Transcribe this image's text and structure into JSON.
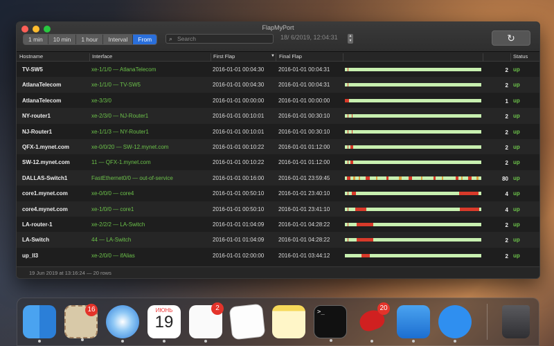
{
  "window": {
    "title": "FlapMyPort",
    "intervals": [
      "1 min",
      "10 min",
      "1 hour",
      "Interval",
      "From"
    ],
    "active_interval": "From",
    "search_placeholder": "Search",
    "date_value": "18/  6/2019, 12:04:31",
    "stepper_icon": "up-down-arrows-icon",
    "refresh_icon": "refresh-icon"
  },
  "columns": {
    "hostname": "Hostname",
    "interface": "Interface",
    "first_flap": "First Flap",
    "final_flap": "Final Flap",
    "status": "Status"
  },
  "rows": [
    {
      "host": "TV-SW5",
      "iface": "xe-1/1/0 — AtlanaTelecom",
      "first": "2016-01-01 00:04:30",
      "final": "2016-01-01 00:04:31",
      "count": "2",
      "status": "up"
    },
    {
      "host": "AtlanaTelecom",
      "iface": "xe-1/1/0 — TV-SW5",
      "first": "2016-01-01 00:04:30",
      "final": "2016-01-01 00:04:31",
      "count": "2",
      "status": "up"
    },
    {
      "host": "AtlanaTelecom",
      "iface": "xe-3/3/0",
      "first": "2016-01-01 00:00:00",
      "final": "2016-01-01 00:00:00",
      "count": "1",
      "status": "up"
    },
    {
      "host": "NY-router1",
      "iface": "xe-2/3/0 — NJ-Router1",
      "first": "2016-01-01 00:10:01",
      "final": "2016-01-01 00:30:10",
      "count": "2",
      "status": "up"
    },
    {
      "host": "NJ-Router1",
      "iface": "xe-1/1/3 — NY-Router1",
      "first": "2016-01-01 00:10:01",
      "final": "2016-01-01 00:30:10",
      "count": "2",
      "status": "up"
    },
    {
      "host": "QFX-1.mynet.com",
      "iface": "xe-0/0/20 — SW-12.mynet.com",
      "first": "2016-01-01 00:10:22",
      "final": "2016-01-01 01:12:00",
      "count": "2",
      "status": "up"
    },
    {
      "host": "SW-12.mynet.com",
      "iface": "11 — QFX-1.mynet.com",
      "first": "2016-01-01 00:10:22",
      "final": "2016-01-01 01:12:00",
      "count": "2",
      "status": "up"
    },
    {
      "host": "DALLAS-Switch1",
      "iface": "FastEthernet0/0 — out-of-service",
      "first": "2016-01-01 00:16:00",
      "final": "2016-01-01 23:59:45",
      "count": "80",
      "status": "up"
    },
    {
      "host": "core1.mynet.com",
      "iface": "xe-0/0/0 — core4",
      "first": "2016-01-01 00:50:10",
      "final": "2016-01-01 23:40:10",
      "count": "4",
      "status": "up"
    },
    {
      "host": "core4.mynet.com",
      "iface": "xe-1/0/0 — core1",
      "first": "2016-01-01 00:50:10",
      "final": "2016-01-01 23:41:10",
      "count": "4",
      "status": "up"
    },
    {
      "host": "LA-router-1",
      "iface": "xe-2/2/2 — LA-Switch",
      "first": "2016-01-01 01:04:09",
      "final": "2016-01-01 04:28:22",
      "count": "2",
      "status": "up"
    },
    {
      "host": "LA-Switch",
      "iface": "44 — LA-Switch",
      "first": "2016-01-01 01:04:09",
      "final": "2016-01-01 04:28:22",
      "count": "2",
      "status": "up"
    },
    {
      "host": "up_ll3",
      "iface": "xe-2/0/0 — ifAlias",
      "first": "2016-01-01 02:00:00",
      "final": "2016-01-01 03:44:12",
      "count": "2",
      "status": "up"
    }
  ],
  "statusbar": "19 Jun 2019 at 13:16:24 — 20 rows",
  "dock": {
    "items": [
      {
        "name": "finder-icon"
      },
      {
        "name": "mail-icon",
        "badge": "16"
      },
      {
        "name": "safari-icon"
      },
      {
        "name": "calendar-icon",
        "month": "ИЮНЬ",
        "day": "19"
      },
      {
        "name": "reminders-icon",
        "badge": "2"
      },
      {
        "name": "textedit-icon"
      },
      {
        "name": "notes-icon"
      },
      {
        "name": "terminal-icon"
      },
      {
        "name": "flapmyport-icon",
        "badge": "20"
      },
      {
        "name": "xcode-icon"
      },
      {
        "name": "messages-icon"
      },
      {
        "name": "trash-icon"
      }
    ]
  },
  "colors": {
    "accent": "#2a6fdb",
    "interface_text": "#6cc24a",
    "status_up": "#6cc24a",
    "timeline_ok": "#c8f0b0",
    "timeline_flap": "#d83a2a"
  }
}
